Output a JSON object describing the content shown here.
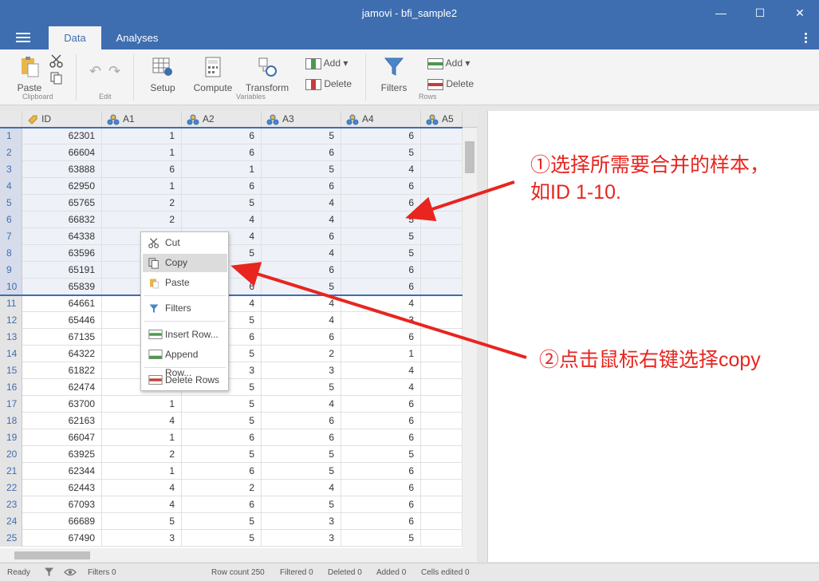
{
  "window": {
    "title": "jamovi - bfi_sample2"
  },
  "tabs": {
    "data": "Data",
    "analyses": "Analyses"
  },
  "ribbon": {
    "paste": "Paste",
    "clipboard": "Clipboard",
    "edit": "Edit",
    "setup": "Setup",
    "compute": "Compute",
    "transform": "Transform",
    "var_add": "Add",
    "var_delete": "Delete",
    "variables": "Variables",
    "filters": "Filters",
    "row_add": "Add",
    "row_delete": "Delete",
    "rows": "Rows"
  },
  "columns": [
    "ID",
    "A1",
    "A2",
    "A3",
    "A4",
    "A5"
  ],
  "rows": [
    [
      "62301",
      "1",
      "6",
      "5",
      "6"
    ],
    [
      "66604",
      "1",
      "6",
      "6",
      "5"
    ],
    [
      "63888",
      "6",
      "1",
      "5",
      "4"
    ],
    [
      "62950",
      "1",
      "6",
      "6",
      "6"
    ],
    [
      "65765",
      "2",
      "5",
      "4",
      "6"
    ],
    [
      "66832",
      "2",
      "4",
      "4",
      "5"
    ],
    [
      "64338",
      "",
      "4",
      "6",
      "5"
    ],
    [
      "63596",
      "",
      "5",
      "4",
      "5"
    ],
    [
      "65191",
      "",
      "",
      "6",
      "6"
    ],
    [
      "65839",
      "",
      "6",
      "5",
      "6"
    ],
    [
      "64661",
      "",
      "4",
      "4",
      "4"
    ],
    [
      "65446",
      "",
      "5",
      "4",
      "3"
    ],
    [
      "67135",
      "",
      "6",
      "6",
      "6"
    ],
    [
      "64322",
      "",
      "5",
      "2",
      "1"
    ],
    [
      "61822",
      "",
      "3",
      "3",
      "4"
    ],
    [
      "62474",
      "",
      "5",
      "5",
      "4"
    ],
    [
      "63700",
      "1",
      "5",
      "4",
      "6"
    ],
    [
      "62163",
      "4",
      "5",
      "6",
      "6"
    ],
    [
      "66047",
      "1",
      "6",
      "6",
      "6"
    ],
    [
      "63925",
      "2",
      "5",
      "5",
      "5"
    ],
    [
      "62344",
      "1",
      "6",
      "5",
      "6"
    ],
    [
      "62443",
      "4",
      "2",
      "4",
      "6"
    ],
    [
      "67093",
      "4",
      "6",
      "5",
      "6"
    ],
    [
      "66689",
      "5",
      "5",
      "3",
      "6"
    ],
    [
      "67490",
      "3",
      "5",
      "3",
      "5"
    ]
  ],
  "selected_rows": 10,
  "context_menu": {
    "cut": "Cut",
    "copy": "Copy",
    "paste": "Paste",
    "filters": "Filters",
    "insert_row": "Insert Row...",
    "append_row": "Append Row...",
    "delete_rows": "Delete Rows"
  },
  "status": {
    "ready": "Ready",
    "filters": "Filters 0",
    "row_count": "Row count 250",
    "filtered": "Filtered 0",
    "deleted": "Deleted 0",
    "added": "Added 0",
    "cells_edited": "Cells edited 0"
  },
  "annotations": {
    "step1_line1": "①选择所需要合并的样本，",
    "step1_line2": "如ID 1-10.",
    "step2": "②点击鼠标右键选择copy"
  },
  "colors": {
    "titlebar": "#3e6eb0",
    "annotation": "#e8251f"
  }
}
